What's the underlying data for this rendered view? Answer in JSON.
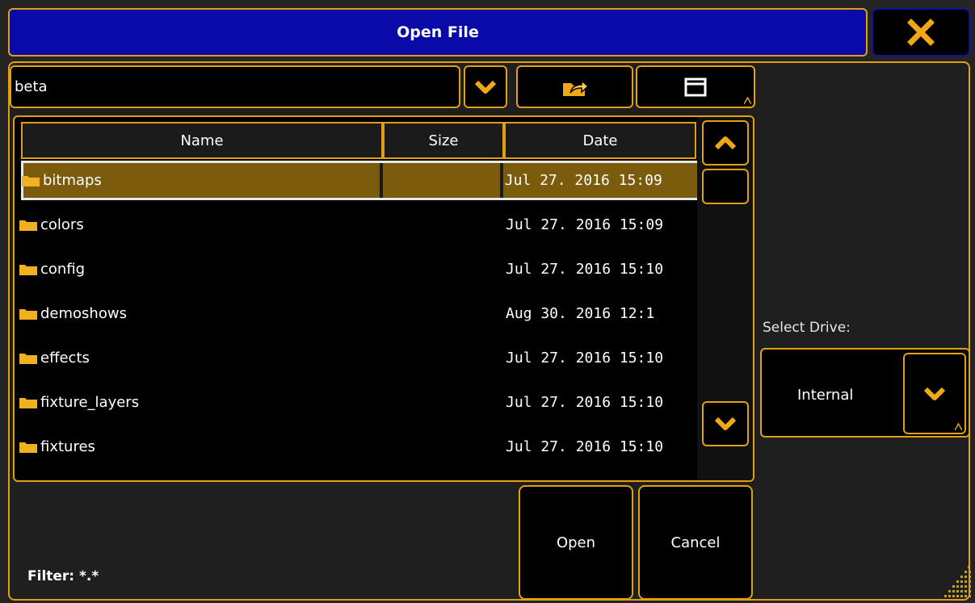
{
  "dialog": {
    "title": "Open File"
  },
  "path": {
    "value": "beta"
  },
  "icons": {
    "close": "close-icon",
    "dropdown": "chevron-down-icon",
    "up_folder": "folder-up-icon",
    "window": "window-icon",
    "scroll_up": "chevron-up-icon",
    "scroll_down": "chevron-down-icon",
    "folder": "folder-icon"
  },
  "colors": {
    "accent": "#e0a010",
    "titlebar": "#0a0aa8",
    "selected_row": "#7a5c0c"
  },
  "table": {
    "columns": [
      "Name",
      "Size",
      "Date"
    ],
    "rows": [
      {
        "name": "bitmaps",
        "size": "",
        "date": "Jul 27. 2016 15:09"
      },
      {
        "name": "colors",
        "size": "",
        "date": "Jul 27. 2016 15:09"
      },
      {
        "name": "config",
        "size": "",
        "date": "Jul 27. 2016 15:10"
      },
      {
        "name": "demoshows",
        "size": "",
        "date": "Aug 30. 2016 12:1"
      },
      {
        "name": "effects",
        "size": "",
        "date": "Jul 27. 2016 15:10"
      },
      {
        "name": "fixture_layers",
        "size": "",
        "date": "Jul 27. 2016 15:10"
      },
      {
        "name": "fixtures",
        "size": "",
        "date": "Jul 27. 2016 15:10"
      }
    ],
    "selected_index": 0
  },
  "drive": {
    "label": "Select Drive:",
    "value": "Internal"
  },
  "buttons": {
    "open": "Open",
    "cancel": "Cancel"
  },
  "filter": {
    "text": "Filter: *.*"
  }
}
